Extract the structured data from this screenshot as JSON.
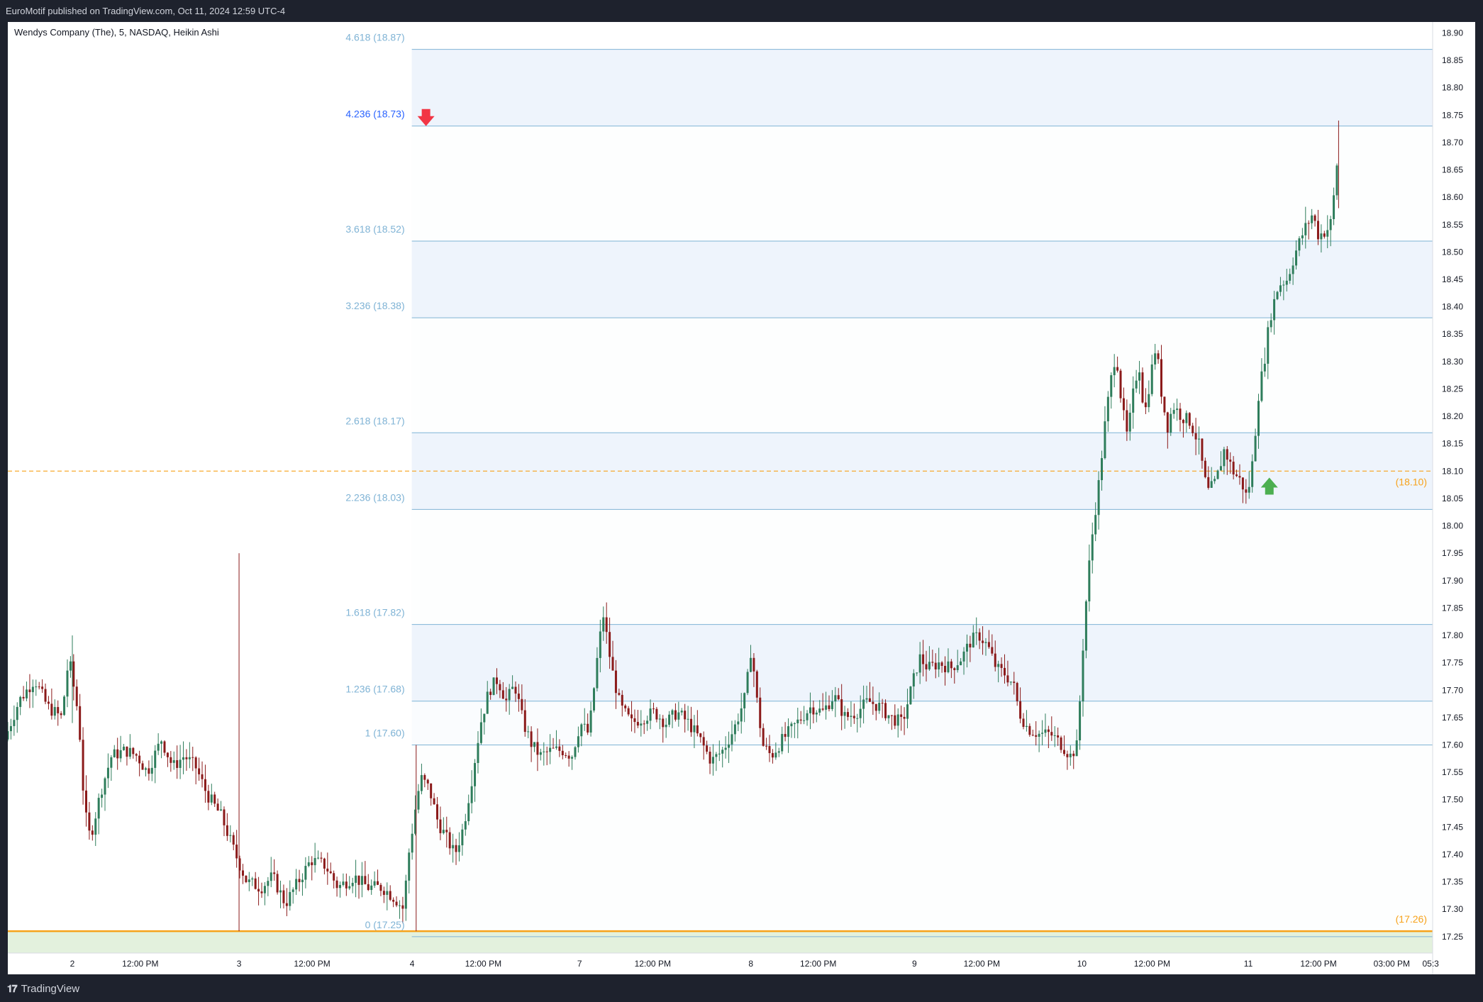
{
  "header": {
    "publish_line": "EuroMotif published on TradingView.com, Oct 11, 2024 12:59 UTC-4"
  },
  "footer": {
    "brand": "TradingView",
    "logo_icon": "tradingview-logo-icon"
  },
  "colors": {
    "up_candle": "#2e7d5b",
    "down_candle": "#8b1a1a",
    "fib_line": "#7fb3d5",
    "fib_fill": "#eaf2fb",
    "orange_level": "#f7a21b",
    "green_zone": "#e3f1dd",
    "down_arrow": "#f23645",
    "up_arrow": "#4caf50"
  },
  "chart_data": {
    "type": "candlestick",
    "title": "Wendys Company (The), 5, NASDAQ, Heikin Ashi",
    "ylim": [
      17.22,
      18.92
    ],
    "price_ticks": [
      "18.90",
      "18.85",
      "18.80",
      "18.75",
      "18.70",
      "18.65",
      "18.60",
      "18.55",
      "18.50",
      "18.45",
      "18.40",
      "18.35",
      "18.30",
      "18.25",
      "18.20",
      "18.15",
      "18.10",
      "18.05",
      "18.00",
      "17.95",
      "17.90",
      "17.85",
      "17.80",
      "17.75",
      "17.70",
      "17.65",
      "17.60",
      "17.55",
      "17.50",
      "17.45",
      "17.40",
      "17.35",
      "17.30",
      "17.25"
    ],
    "time_ticks": [
      {
        "label": "2",
        "pos": 0.0453
      },
      {
        "label": "12:00 PM",
        "pos": 0.093
      },
      {
        "label": "3",
        "pos": 0.1623
      },
      {
        "label": "12:00 PM",
        "pos": 0.2136
      },
      {
        "label": "4",
        "pos": 0.2838
      },
      {
        "label": "12:00 PM",
        "pos": 0.3337
      },
      {
        "label": "7",
        "pos": 0.4013
      },
      {
        "label": "12:00 PM",
        "pos": 0.4526
      },
      {
        "label": "8",
        "pos": 0.5215
      },
      {
        "label": "12:00 PM",
        "pos": 0.5688
      },
      {
        "label": "9",
        "pos": 0.6363
      },
      {
        "label": "12:00 PM",
        "pos": 0.6836
      },
      {
        "label": "10",
        "pos": 0.7538
      },
      {
        "label": "12:00 PM",
        "pos": 0.8031
      },
      {
        "label": "11",
        "pos": 0.8706
      },
      {
        "label": "12:00 PM",
        "pos": 0.9199
      },
      {
        "label": "03:00 PM",
        "pos": 0.9713
      },
      {
        "label": "05:3",
        "pos": 0.9986
      }
    ],
    "fib_levels": [
      {
        "label": "4.618 (18.87)",
        "price": 18.87
      },
      {
        "label": "4.236 (18.73)",
        "price": 18.73
      },
      {
        "label": "3.618 (18.52)",
        "price": 18.52
      },
      {
        "label": "3.236 (18.38)",
        "price": 18.38
      },
      {
        "label": "2.618 (18.17)",
        "price": 18.17
      },
      {
        "label": "2.236 (18.03)",
        "price": 18.03
      },
      {
        "label": "1.618 (17.82)",
        "price": 17.82
      },
      {
        "label": "1.236 (17.68)",
        "price": 17.68
      },
      {
        "label": "1 (17.60)",
        "price": 17.6
      },
      {
        "label": "0 (17.25)",
        "price": 17.25
      }
    ],
    "horizontal_levels": [
      {
        "label": "(18.10)",
        "price": 18.1,
        "style": "dashed"
      },
      {
        "label": "(17.26)",
        "price": 17.26,
        "style": "solid"
      }
    ],
    "markers": [
      {
        "type": "down-arrow",
        "pos": 0.2935,
        "price": 18.73
      },
      {
        "type": "up-arrow",
        "pos": 0.8854,
        "price": 18.07
      }
    ],
    "path_points": [
      [
        0.0,
        17.61
      ],
      [
        0.01,
        17.68
      ],
      [
        0.021,
        17.72
      ],
      [
        0.03,
        17.67
      ],
      [
        0.04,
        17.65
      ],
      [
        0.045,
        17.76
      ],
      [
        0.052,
        17.65
      ],
      [
        0.056,
        17.48
      ],
      [
        0.06,
        17.43
      ],
      [
        0.068,
        17.52
      ],
      [
        0.075,
        17.58
      ],
      [
        0.085,
        17.59
      ],
      [
        0.093,
        17.58
      ],
      [
        0.1,
        17.55
      ],
      [
        0.11,
        17.61
      ],
      [
        0.118,
        17.56
      ],
      [
        0.126,
        17.58
      ],
      [
        0.134,
        17.56
      ],
      [
        0.142,
        17.51
      ],
      [
        0.152,
        17.47
      ],
      [
        0.162,
        17.4
      ],
      [
        0.17,
        17.35
      ],
      [
        0.18,
        17.34
      ],
      [
        0.188,
        17.36
      ],
      [
        0.197,
        17.31
      ],
      [
        0.206,
        17.35
      ],
      [
        0.215,
        17.39
      ],
      [
        0.225,
        17.38
      ],
      [
        0.234,
        17.34
      ],
      [
        0.245,
        17.36
      ],
      [
        0.255,
        17.34
      ],
      [
        0.265,
        17.34
      ],
      [
        0.274,
        17.32
      ],
      [
        0.28,
        17.3
      ],
      [
        0.283,
        17.39
      ],
      [
        0.288,
        17.48
      ],
      [
        0.292,
        17.54
      ],
      [
        0.298,
        17.52
      ],
      [
        0.304,
        17.46
      ],
      [
        0.31,
        17.43
      ],
      [
        0.316,
        17.4
      ],
      [
        0.322,
        17.45
      ],
      [
        0.328,
        17.54
      ],
      [
        0.334,
        17.64
      ],
      [
        0.34,
        17.7
      ],
      [
        0.346,
        17.72
      ],
      [
        0.352,
        17.68
      ],
      [
        0.358,
        17.71
      ],
      [
        0.364,
        17.64
      ],
      [
        0.37,
        17.6
      ],
      [
        0.376,
        17.58
      ],
      [
        0.384,
        17.59
      ],
      [
        0.392,
        17.59
      ],
      [
        0.398,
        17.58
      ],
      [
        0.404,
        17.64
      ],
      [
        0.41,
        17.62
      ],
      [
        0.416,
        17.76
      ],
      [
        0.42,
        17.84
      ],
      [
        0.426,
        17.74
      ],
      [
        0.432,
        17.67
      ],
      [
        0.44,
        17.64
      ],
      [
        0.448,
        17.65
      ],
      [
        0.456,
        17.66
      ],
      [
        0.464,
        17.64
      ],
      [
        0.472,
        17.66
      ],
      [
        0.48,
        17.64
      ],
      [
        0.488,
        17.61
      ],
      [
        0.496,
        17.57
      ],
      [
        0.504,
        17.59
      ],
      [
        0.512,
        17.63
      ],
      [
        0.52,
        17.69
      ],
      [
        0.524,
        17.78
      ],
      [
        0.528,
        17.68
      ],
      [
        0.532,
        17.6
      ],
      [
        0.538,
        17.58
      ],
      [
        0.546,
        17.61
      ],
      [
        0.556,
        17.64
      ],
      [
        0.566,
        17.67
      ],
      [
        0.574,
        17.66
      ],
      [
        0.582,
        17.69
      ],
      [
        0.59,
        17.65
      ],
      [
        0.598,
        17.66
      ],
      [
        0.606,
        17.68
      ],
      [
        0.614,
        17.67
      ],
      [
        0.622,
        17.65
      ],
      [
        0.63,
        17.64
      ],
      [
        0.636,
        17.7
      ],
      [
        0.642,
        17.76
      ],
      [
        0.648,
        17.74
      ],
      [
        0.656,
        17.75
      ],
      [
        0.664,
        17.74
      ],
      [
        0.672,
        17.76
      ],
      [
        0.678,
        17.79
      ],
      [
        0.684,
        17.8
      ],
      [
        0.69,
        17.78
      ],
      [
        0.696,
        17.74
      ],
      [
        0.702,
        17.73
      ],
      [
        0.708,
        17.71
      ],
      [
        0.712,
        17.66
      ],
      [
        0.718,
        17.63
      ],
      [
        0.726,
        17.62
      ],
      [
        0.734,
        17.62
      ],
      [
        0.742,
        17.6
      ],
      [
        0.748,
        17.58
      ],
      [
        0.753,
        17.6
      ],
      [
        0.756,
        17.75
      ],
      [
        0.76,
        17.9
      ],
      [
        0.764,
        18.0
      ],
      [
        0.768,
        18.08
      ],
      [
        0.772,
        18.18
      ],
      [
        0.776,
        18.26
      ],
      [
        0.78,
        18.32
      ],
      [
        0.784,
        18.22
      ],
      [
        0.788,
        18.16
      ],
      [
        0.792,
        18.24
      ],
      [
        0.796,
        18.3
      ],
      [
        0.8,
        18.2
      ],
      [
        0.804,
        18.27
      ],
      [
        0.808,
        18.33
      ],
      [
        0.812,
        18.24
      ],
      [
        0.816,
        18.18
      ],
      [
        0.82,
        18.22
      ],
      [
        0.826,
        18.2
      ],
      [
        0.832,
        18.19
      ],
      [
        0.838,
        18.15
      ],
      [
        0.844,
        18.06
      ],
      [
        0.85,
        18.08
      ],
      [
        0.856,
        18.14
      ],
      [
        0.862,
        18.1
      ],
      [
        0.868,
        18.08
      ],
      [
        0.872,
        18.05
      ],
      [
        0.876,
        18.12
      ],
      [
        0.88,
        18.24
      ],
      [
        0.884,
        18.3
      ],
      [
        0.888,
        18.38
      ],
      [
        0.894,
        18.44
      ],
      [
        0.9,
        18.45
      ],
      [
        0.906,
        18.5
      ],
      [
        0.912,
        18.54
      ],
      [
        0.918,
        18.57
      ],
      [
        0.922,
        18.53
      ],
      [
        0.928,
        18.54
      ],
      [
        0.932,
        18.56
      ],
      [
        0.934,
        18.66
      ]
    ]
  }
}
